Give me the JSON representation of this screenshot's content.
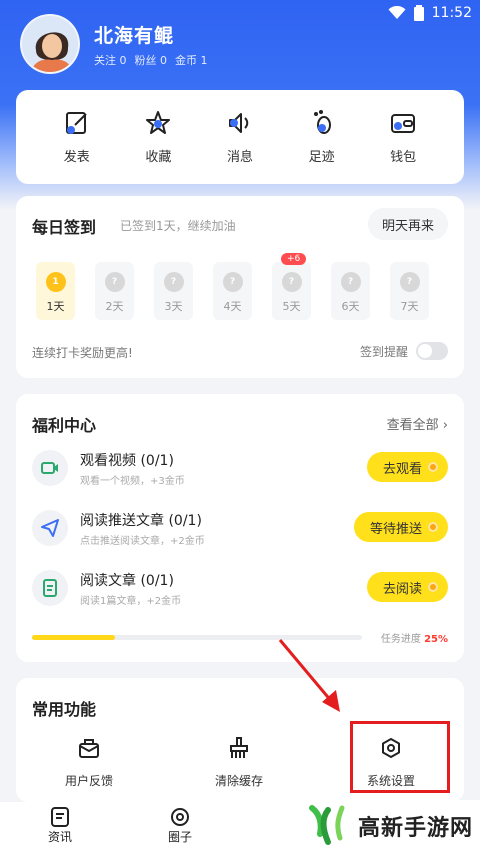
{
  "status": {
    "time": "11:52"
  },
  "profile": {
    "name": "北海有鲲",
    "following": "关注 0",
    "fans": "粉丝 0",
    "coins": "金币 1"
  },
  "quick": [
    {
      "label": "发表",
      "icon": "edit-icon"
    },
    {
      "label": "收藏",
      "icon": "star-icon"
    },
    {
      "label": "消息",
      "icon": "speaker-icon"
    },
    {
      "label": "足迹",
      "icon": "footprint-icon"
    },
    {
      "label": "钱包",
      "icon": "wallet-icon"
    }
  ],
  "checkin": {
    "title": "每日签到",
    "subtitle": "已签到1天，继续加油",
    "button": "明天再来",
    "days": [
      {
        "label": "1天",
        "done": true
      },
      {
        "label": "2天",
        "done": false
      },
      {
        "label": "3天",
        "done": false
      },
      {
        "label": "4天",
        "done": false
      },
      {
        "label": "5天",
        "done": false,
        "bonus": "+6"
      },
      {
        "label": "6天",
        "done": false
      },
      {
        "label": "7天",
        "done": false
      }
    ],
    "coin_glyph_done": "1",
    "coin_glyph": "?",
    "footer": "连续打卡奖励更高!",
    "remind": "签到提醒",
    "remind_on": false
  },
  "welfare": {
    "title": "福利中心",
    "see_all": "查看全部",
    "tasks": [
      {
        "name": "观看视频 (0/1)",
        "desc": "观看一个视频，+3金币",
        "button": "去观看",
        "icon": "video-icon"
      },
      {
        "name": "阅读推送文章 (0/1)",
        "desc": "点击推送阅读文章，+2金币",
        "button": "等待推送",
        "icon": "send-icon"
      },
      {
        "name": "阅读文章 (0/1)",
        "desc": "阅读1篇文章，+2金币",
        "button": "去阅读",
        "icon": "article-icon"
      }
    ],
    "progress_label": "任务进度",
    "progress_value": "25%",
    "progress": 0.25
  },
  "common": {
    "title": "常用功能",
    "items": [
      {
        "label": "用户反馈",
        "icon": "feedback-icon"
      },
      {
        "label": "清除缓存",
        "icon": "broom-icon"
      },
      {
        "label": "系统设置",
        "icon": "settings-icon"
      }
    ]
  },
  "tabbar": [
    {
      "label": "资讯",
      "icon": "news-icon"
    },
    {
      "label": "圈子",
      "icon": "circle-icon"
    }
  ],
  "watermark": "高新手游网",
  "colors": {
    "primary": "#2f63f2",
    "accent": "#ffe01b",
    "highlight": "#e41e1e"
  }
}
